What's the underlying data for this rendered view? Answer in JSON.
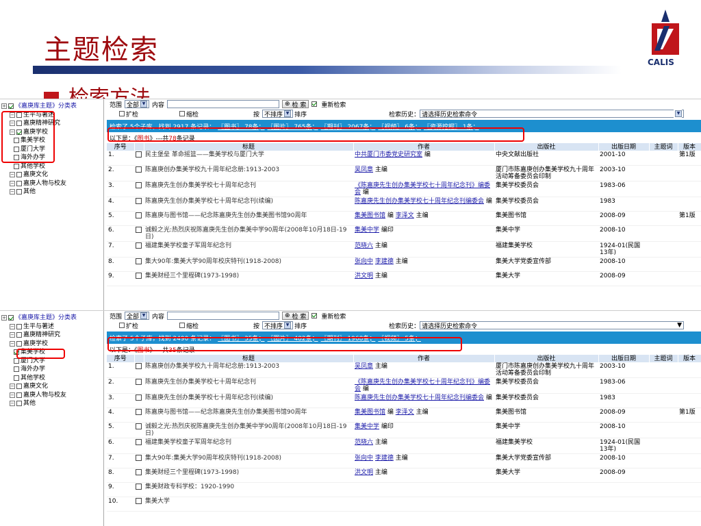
{
  "slide": {
    "title": "主题检索",
    "subheading": "检索方法",
    "logo_text": "CALIS"
  },
  "colors": {
    "title": "#9e0b0f",
    "status_bar": "#1d8fcf",
    "highlight": "#e00000",
    "link": "#1a1aa8"
  },
  "search": {
    "range_label": "范围",
    "range_value": "全部",
    "content_label": "内容",
    "search_button": "检 索",
    "research_label": "重新检索",
    "expand_label": "扩检",
    "narrow_label": "缩检",
    "sort_by_label": "按",
    "sort_value": "不排序",
    "sort_label": "排序",
    "history_label": "检索历史：",
    "history_placeholder": "请选择历史检索命令"
  },
  "panel1": {
    "tree": [
      {
        "label": "《嘉庚库主题》分类表",
        "checked": true,
        "level": 0,
        "link": true
      },
      {
        "label": "生平与著述",
        "checked": false,
        "level": 1
      },
      {
        "label": "嘉庚精神研究",
        "checked": false,
        "level": 1
      },
      {
        "label": "嘉庚学校",
        "checked": true,
        "level": 1
      },
      {
        "label": "集美学校",
        "checked": false,
        "level": 2
      },
      {
        "label": "厦门大学",
        "checked": false,
        "level": 2
      },
      {
        "label": "海外办学",
        "checked": false,
        "level": 2
      },
      {
        "label": "其他学校",
        "checked": false,
        "level": 2
      },
      {
        "label": "嘉庚文化",
        "checked": false,
        "level": 1
      },
      {
        "label": "嘉庚人物与校友",
        "checked": false,
        "level": 1
      },
      {
        "label": "其他",
        "checked": false,
        "level": 1
      }
    ],
    "status": {
      "prefix": "检索了 5个子库，找到 2917 条记录：",
      "tags": [
        "〖图书〗 78条；",
        "〖图片〗 765条；",
        "〖期刊〗 2067条；",
        "〖视频〗 6条；",
        "〖资源挖掘〗 1条；"
      ]
    },
    "result_header": {
      "prefix": "以下是：《",
      "type": "图书",
      "suffix": "》---共",
      "count": "78",
      "unit": "条记录"
    },
    "columns": [
      "序号",
      "",
      "标题",
      "作者",
      "出版社",
      "出版日期",
      "主题词",
      "版本"
    ],
    "rows": [
      {
        "num": "1.",
        "title": "民主堡垒 革命摇篮——集美学校与厦门大学",
        "author_link": "中共厦门市委党史研究室",
        "author_rest": " 编",
        "publisher": "中央文献出版社",
        "date": "2001-10",
        "edition": "第1版"
      },
      {
        "num": "2.",
        "title": "陈嘉庚创办集美学校九十周年纪念册:1913-2003",
        "author_link": "吴凤章",
        "author_rest": " 主编",
        "publisher": "厦门市陈嘉庚创办集美学校九十周年活动筹备委员会印制",
        "date": "2003-10",
        "edition": ""
      },
      {
        "num": "3.",
        "title": "陈嘉庚先生创办集美学校七十周年纪念刊",
        "author_link": "《陈嘉庚先生创办集美学校七十周年纪念刊》编委会",
        "author_rest": " 编",
        "publisher": "集美学校委员会",
        "date": "1983-06",
        "edition": ""
      },
      {
        "num": "4.",
        "title": "陈嘉庚先生创办集美学校七十周年纪念刊(续编)",
        "author_link": "陈嘉庚先生创办集美学校七十周年纪念刊编委会",
        "author_rest": " 编",
        "publisher": "集美学校委员会",
        "date": "1983",
        "edition": ""
      },
      {
        "num": "5.",
        "title": "陈嘉庚与图书馆——纪念陈嘉庚先生创办集美图书馆90周年",
        "author_link": "集美图书馆",
        "author_rest": " 编 ",
        "author_link2": "李泽文",
        "author_rest2": " 主编",
        "publisher": "集美图书馆",
        "date": "2008-09",
        "edition": "第1版"
      },
      {
        "num": "6.",
        "title": "诚毅之光:热烈庆祝陈嘉庚先生创办集美中学90周年(2008年10月18日-19日)",
        "author_link": "集美中学",
        "author_rest": " 编印",
        "publisher": "集美中学",
        "date": "2008-10",
        "edition": ""
      },
      {
        "num": "7.",
        "title": "福建集美学校童子军周年纪念刊",
        "author_link": "范晓六",
        "author_rest": " 主编",
        "publisher": "福建集美学校",
        "date": "1924-01(民国13年)",
        "edition": ""
      },
      {
        "num": "8.",
        "title": "集大90年:集美大学90周年校庆特刊(1918-2008)",
        "author_link": "张向中",
        "author_rest": " ",
        "author_link2": "李建德",
        "author_rest2": " 主编",
        "publisher": "集美大学党委宣传部",
        "date": "2008-10",
        "edition": ""
      },
      {
        "num": "9.",
        "title": "集美财经三个里程碑(1973-1998)",
        "author_link": "洪文明",
        "author_rest": " 主编",
        "publisher": "集美大学",
        "date": "2008-09",
        "edition": ""
      }
    ]
  },
  "panel2": {
    "tree": [
      {
        "label": "《嘉庚库主题》分类表",
        "checked": true,
        "level": 0,
        "link": true
      },
      {
        "label": "生平与著述",
        "checked": false,
        "level": 1
      },
      {
        "label": "嘉庚精神研究",
        "checked": false,
        "level": 1
      },
      {
        "label": "嘉庚学校",
        "checked": false,
        "level": 1
      },
      {
        "label": "集美学校",
        "checked": true,
        "level": 2
      },
      {
        "label": "厦门大学",
        "checked": false,
        "level": 2
      },
      {
        "label": "海外办学",
        "checked": false,
        "level": 2
      },
      {
        "label": "其他学校",
        "checked": false,
        "level": 2
      },
      {
        "label": "嘉庚文化",
        "checked": false,
        "level": 1
      },
      {
        "label": "嘉庚人物与校友",
        "checked": false,
        "level": 1
      },
      {
        "label": "其他",
        "checked": false,
        "level": 1
      }
    ],
    "status": {
      "prefix": "检索了 5个子库，找到 2490 条记录：",
      "tags": [
        "〖图书〗 35条；",
        "〖图片〗 482条；",
        "〖期刊〗 1968条；",
        "〖视频〗 5条；"
      ]
    },
    "result_header": {
      "prefix": "以下是：《",
      "type": "图书",
      "suffix": "》---共",
      "count": "35",
      "unit": "条记录"
    },
    "columns": [
      "序号",
      "",
      "标题",
      "作者",
      "出版社",
      "出版日期",
      "主题词",
      "版本"
    ],
    "rows": [
      {
        "num": "1.",
        "title": "陈嘉庚创办集美学校九十周年纪念册:1913-2003",
        "author_link": "吴凤章",
        "author_rest": " 主编",
        "publisher": "厦门市陈嘉庚创办集美学校九十周年活动筹备委员会印制",
        "date": "2003-10",
        "edition": ""
      },
      {
        "num": "2.",
        "title": "陈嘉庚先生创办集美学校七十周年纪念刊",
        "author_link": "《陈嘉庚先生创办集美学校七十周年纪念刊》编委会",
        "author_rest": " 编",
        "publisher": "集美学校委员会",
        "date": "1983-06",
        "edition": ""
      },
      {
        "num": "3.",
        "title": "陈嘉庚先生创办集美学校七十周年纪念刊(续编)",
        "author_link": "陈嘉庚先生创办集美学校七十周年纪念刊编委会",
        "author_rest": " 编",
        "publisher": "集美学校委员会",
        "date": "1983",
        "edition": ""
      },
      {
        "num": "4.",
        "title": "陈嘉庚与图书馆——纪念陈嘉庚先生创办集美图书馆90周年",
        "author_link": "集美图书馆",
        "author_rest": " 编 ",
        "author_link2": "李泽文",
        "author_rest2": " 主编",
        "publisher": "集美图书馆",
        "date": "2008-09",
        "edition": "第1版"
      },
      {
        "num": "5.",
        "title": "诚毅之光:热烈庆祝陈嘉庚先生创办集美中学90周年(2008年10月18日-19日)",
        "author_link": "集美中学",
        "author_rest": " 编印",
        "publisher": "集美中学",
        "date": "2008-10",
        "edition": ""
      },
      {
        "num": "6.",
        "title": "福建集美学校童子军周年纪念刊",
        "author_link": "范晓六",
        "author_rest": " 主编",
        "publisher": "福建集美学校",
        "date": "1924-01(民国13年)",
        "edition": ""
      },
      {
        "num": "7.",
        "title": "集大90年:集美大学90周年校庆特刊(1918-2008)",
        "author_link": "张向中",
        "author_rest": " ",
        "author_link2": "李建德",
        "author_rest2": " 主编",
        "publisher": "集美大学党委宣传部",
        "date": "2008-10",
        "edition": ""
      },
      {
        "num": "8.",
        "title": "集美财经三个里程碑(1973-1998)",
        "author_link": "洪文明",
        "author_rest": " 主编",
        "publisher": "集美大学",
        "date": "2008-09",
        "edition": ""
      },
      {
        "num": "9.",
        "title": "集美财政专科学校：1920-1990",
        "author_link": "",
        "author_rest": "",
        "publisher": "",
        "date": "",
        "edition": ""
      },
      {
        "num": "10.",
        "title": "集美大学",
        "author_link": "",
        "author_rest": "",
        "publisher": "",
        "date": "",
        "edition": ""
      }
    ]
  }
}
